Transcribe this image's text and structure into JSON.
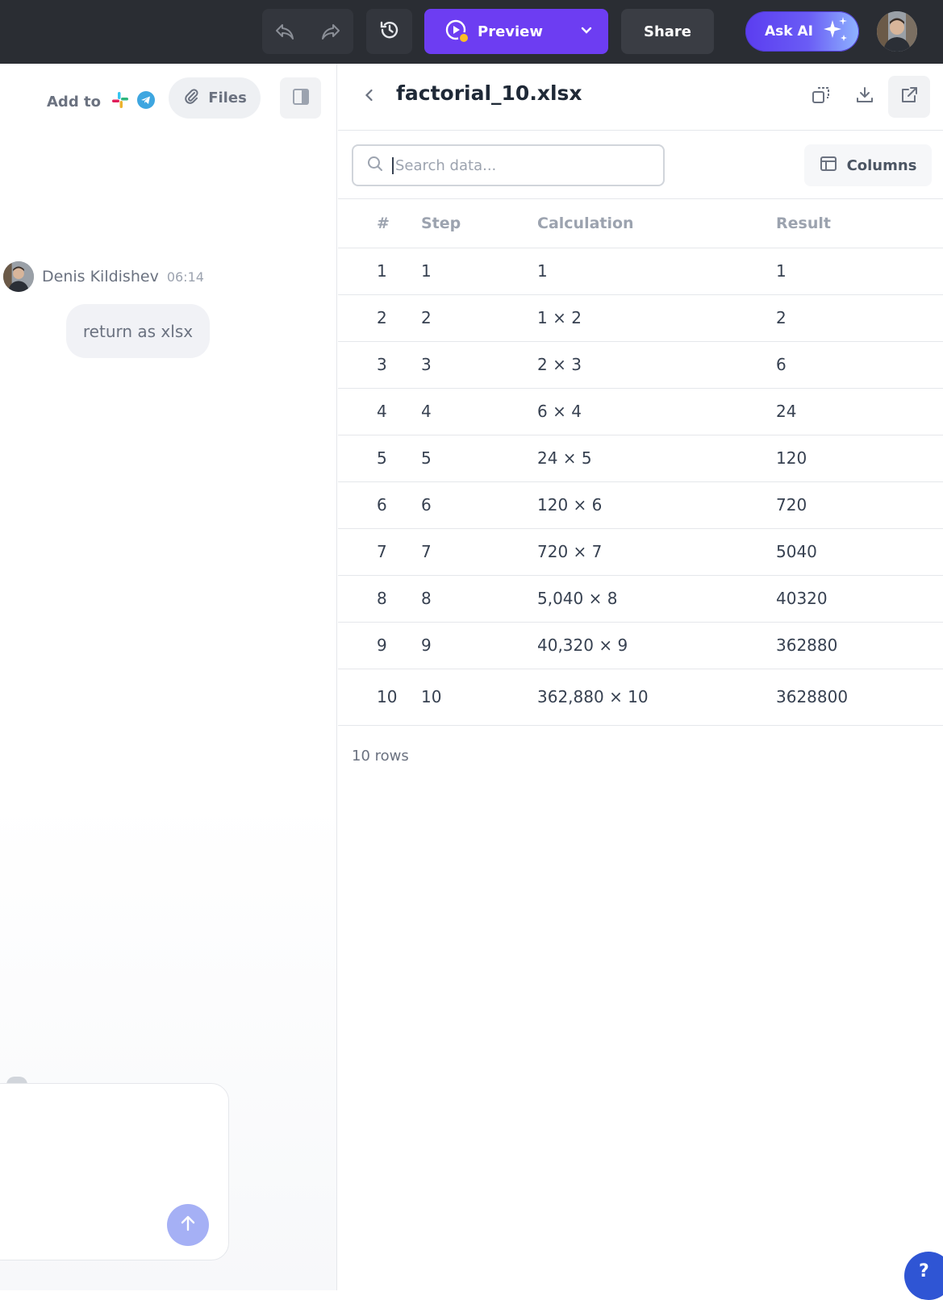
{
  "topbar": {
    "preview_label": "Preview",
    "share_label": "Share",
    "ask_ai_label": "Ask AI",
    "accent": "#6d3df2"
  },
  "left": {
    "add_to_label": "Add to",
    "files_label": "Files",
    "message": {
      "author": "Denis Kildishev",
      "time": "06:14",
      "text": "return as xlsx"
    }
  },
  "viewer": {
    "file_name": "factorial_10.xlsx",
    "search_placeholder": "Search data...",
    "columns_label": "Columns",
    "headers": [
      "#",
      "Step",
      "Calculation",
      "Result"
    ],
    "rows": [
      [
        "1",
        "1",
        "1",
        "1"
      ],
      [
        "2",
        "2",
        "1 × 2",
        "2"
      ],
      [
        "3",
        "3",
        "2 × 3",
        "6"
      ],
      [
        "4",
        "4",
        "6 × 4",
        "24"
      ],
      [
        "5",
        "5",
        "24 × 5",
        "120"
      ],
      [
        "6",
        "6",
        "120 × 6",
        "720"
      ],
      [
        "7",
        "7",
        "720 × 7",
        "5040"
      ],
      [
        "8",
        "8",
        "5,040 × 8",
        "40320"
      ],
      [
        "9",
        "9",
        "40,320 × 9",
        "362880"
      ],
      [
        "10",
        "10",
        "362,880 × 10",
        "3628800"
      ]
    ],
    "row_count_label": "10 rows"
  },
  "help_label": "?"
}
